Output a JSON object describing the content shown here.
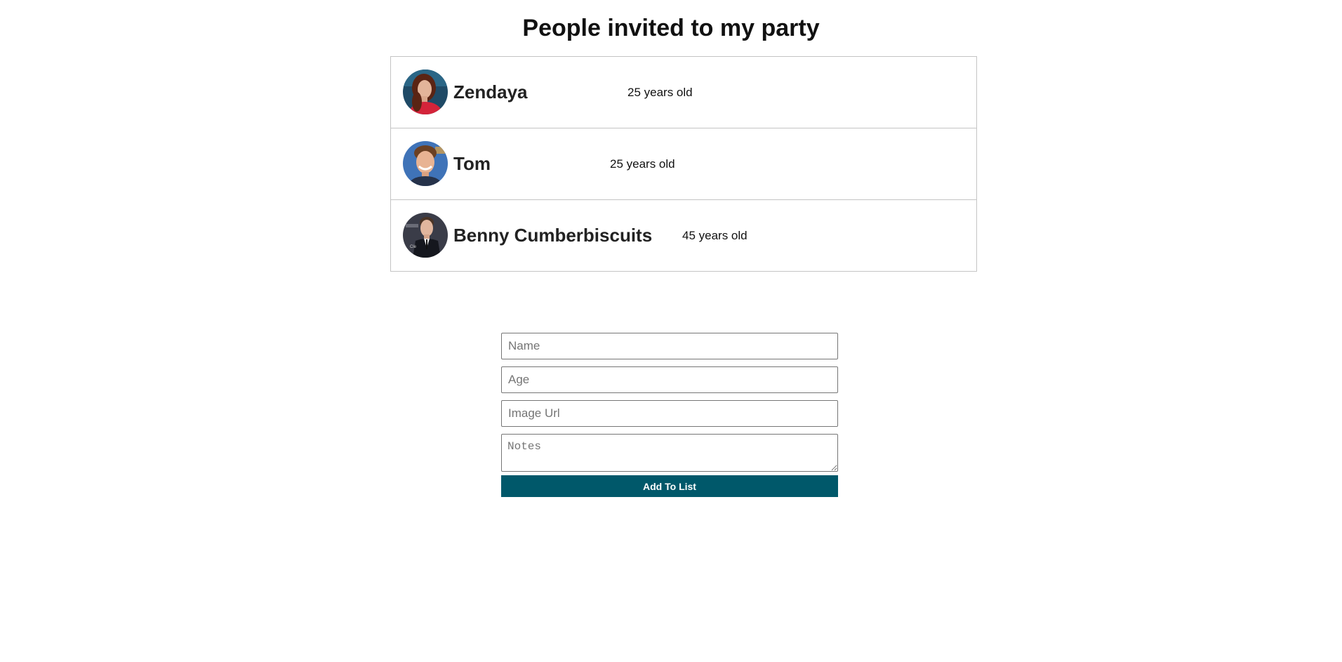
{
  "page": {
    "title": "People invited to my party"
  },
  "guests": [
    {
      "name": "Zendaya",
      "age": "25 years old"
    },
    {
      "name": "Tom",
      "age": "25 years old"
    },
    {
      "name": "Benny Cumberbiscuits",
      "age": "45 years old"
    }
  ],
  "form": {
    "name_placeholder": "Name",
    "age_placeholder": "Age",
    "image_placeholder": "Image Url",
    "notes_placeholder": "Notes",
    "submit_label": "Add To List"
  },
  "colors": {
    "button_bg": "#00586a",
    "button_text": "#ffffff",
    "row_border": "#c4c4c4"
  }
}
